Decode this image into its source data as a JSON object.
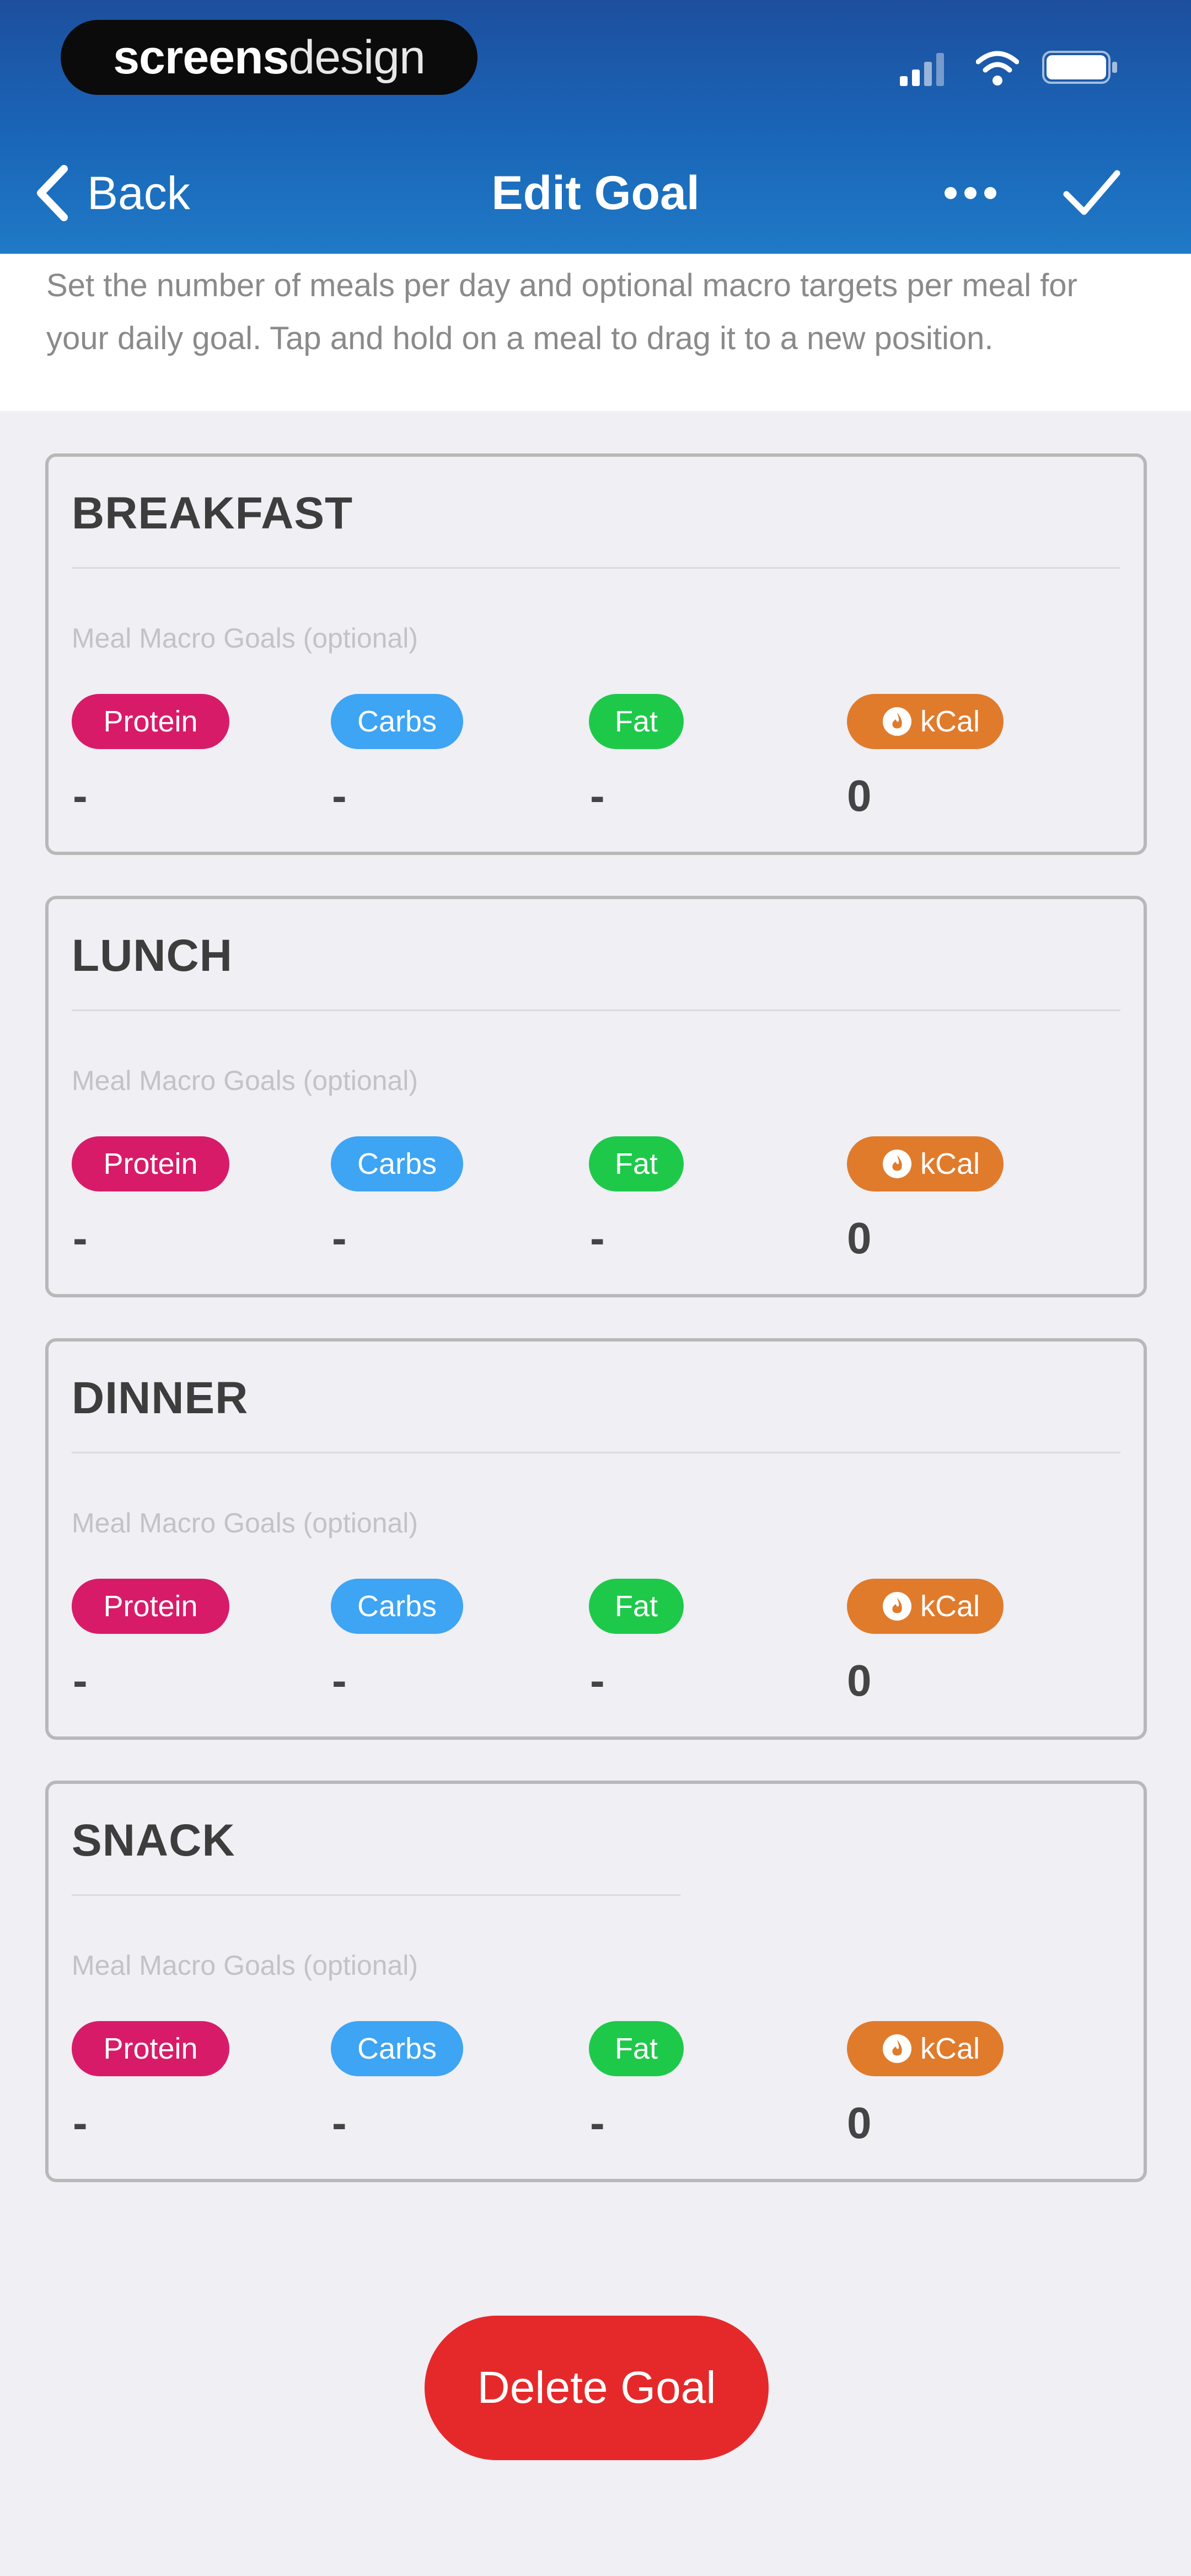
{
  "status_bar": {
    "brand_bold": "screens",
    "brand_light": "design"
  },
  "nav": {
    "back_label": "Back",
    "title": "Edit Goal"
  },
  "instructions": "Set the number of meals per day and optional macro targets per meal for your daily goal. Tap and hold on a meal to drag it to a new position.",
  "macro_labels": {
    "protein": "Protein",
    "carbs": "Carbs",
    "fat": "Fat",
    "kcal": "kCal"
  },
  "macro_hint": "Meal Macro Goals (optional)",
  "meals": [
    {
      "name": "BREAKFAST",
      "protein": "-",
      "carbs": "-",
      "fat": "-",
      "kcal": "0"
    },
    {
      "name": "LUNCH",
      "protein": "-",
      "carbs": "-",
      "fat": "-",
      "kcal": "0"
    },
    {
      "name": "DINNER",
      "protein": "-",
      "carbs": "-",
      "fat": "-",
      "kcal": "0"
    },
    {
      "name": "SNACK",
      "protein": "-",
      "carbs": "-",
      "fat": "-",
      "kcal": "0"
    }
  ],
  "delete_label": "Delete Goal",
  "colors": {
    "header_top": "#1d4f9e",
    "header_bottom": "#1f7ac6",
    "protein": "#d81b68",
    "carbs": "#3ea4f4",
    "fat": "#1ec94a",
    "kcal": "#e07b2c",
    "delete": "#e5292a"
  },
  "icons": [
    "back-chevron-icon",
    "more-icon",
    "checkmark-icon",
    "signal-icon",
    "wifi-icon",
    "battery-icon",
    "flame-icon"
  ]
}
